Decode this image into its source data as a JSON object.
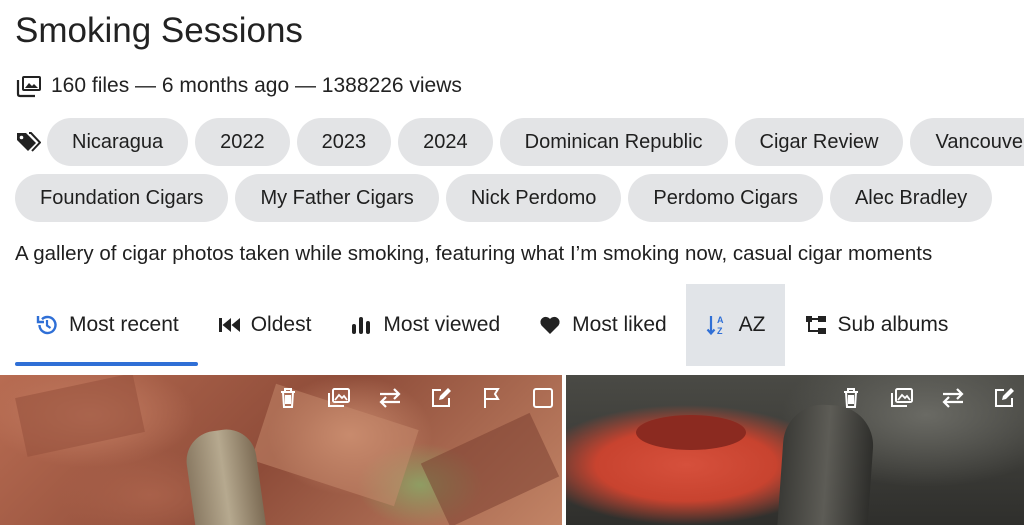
{
  "album": {
    "title": "Smoking Sessions",
    "meta": "160 files — 6 months ago — 1388226 views",
    "description": "A gallery of cigar photos taken while smoking, featuring what I’m smoking now, casual cigar moments"
  },
  "tags": {
    "row1": [
      "Nicaragua",
      "2022",
      "2023",
      "2024",
      "Dominican Republic",
      "Cigar Review",
      "Vancouver"
    ],
    "row2": [
      "Foundation Cigars",
      "My Father Cigars",
      "Nick Perdomo",
      "Perdomo Cigars",
      "Alec Bradley"
    ]
  },
  "sort_tabs": [
    {
      "label": "Most recent",
      "icon": "history-icon"
    },
    {
      "label": "Oldest",
      "icon": "fast-rewind-icon"
    },
    {
      "label": "Most viewed",
      "icon": "bar-chart-icon"
    },
    {
      "label": "Most liked",
      "icon": "heart-icon"
    },
    {
      "label": "AZ",
      "icon": "sort-az-icon"
    },
    {
      "label": "Sub albums",
      "icon": "tree-icon"
    }
  ],
  "active_tab": "Most recent",
  "selected_tab": "AZ",
  "colors": {
    "accent": "#2f6fd6",
    "tag_bg": "#e3e4e6",
    "selected_tab_bg": "#e1e4e8"
  },
  "photo_actions": [
    "delete-icon",
    "set-cover-icon",
    "move-icon",
    "edit-icon",
    "flag-icon",
    "select-checkbox"
  ]
}
